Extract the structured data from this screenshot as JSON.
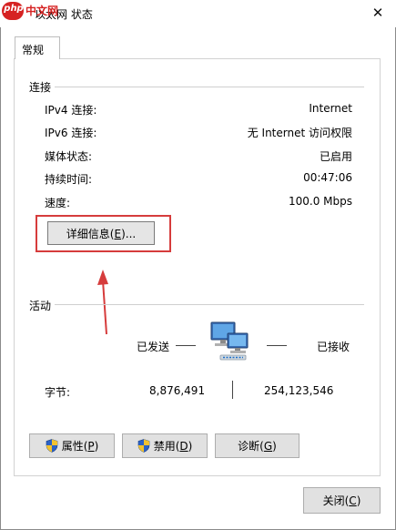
{
  "window": {
    "title": "以太网 状态",
    "close_glyph": "✕"
  },
  "watermark": {
    "logo_text": "php",
    "site_text": "中文网"
  },
  "tabs": [
    {
      "label": "常规",
      "selected": true
    }
  ],
  "connection": {
    "section_title": "连接",
    "rows": [
      {
        "label": "IPv4 连接:",
        "value": "Internet"
      },
      {
        "label": "IPv6 连接:",
        "value": "无 Internet 访问权限"
      },
      {
        "label": "媒体状态:",
        "value": "已启用"
      },
      {
        "label": "持续时间:",
        "value": "00:47:06"
      },
      {
        "label": "速度:",
        "value": "100.0 Mbps"
      }
    ],
    "details_button": {
      "label": "详细信息(",
      "mnemonic": "E",
      "suffix": ")..."
    }
  },
  "activity": {
    "section_title": "活动",
    "sent_label": "已发送",
    "received_label": "已接收",
    "bytes_label": "字节:",
    "bytes_sent": "8,876,491",
    "bytes_received": "254,123,546"
  },
  "actions": {
    "properties": {
      "label": "属性(",
      "mnemonic": "P",
      "suffix": ")",
      "icon": "uac-shield-icon"
    },
    "disable": {
      "label": "禁用(",
      "mnemonic": "D",
      "suffix": ")",
      "icon": "uac-shield-icon"
    },
    "diagnose": {
      "label": "诊断(",
      "mnemonic": "G",
      "suffix": ")"
    }
  },
  "footer": {
    "close_button": {
      "label": "关闭(",
      "mnemonic": "C",
      "suffix": ")"
    }
  },
  "colors": {
    "annotation_red": "#d63c3c",
    "button_face": "#e1e1e1",
    "button_border": "#adadad",
    "watermark_red": "#d62222"
  }
}
